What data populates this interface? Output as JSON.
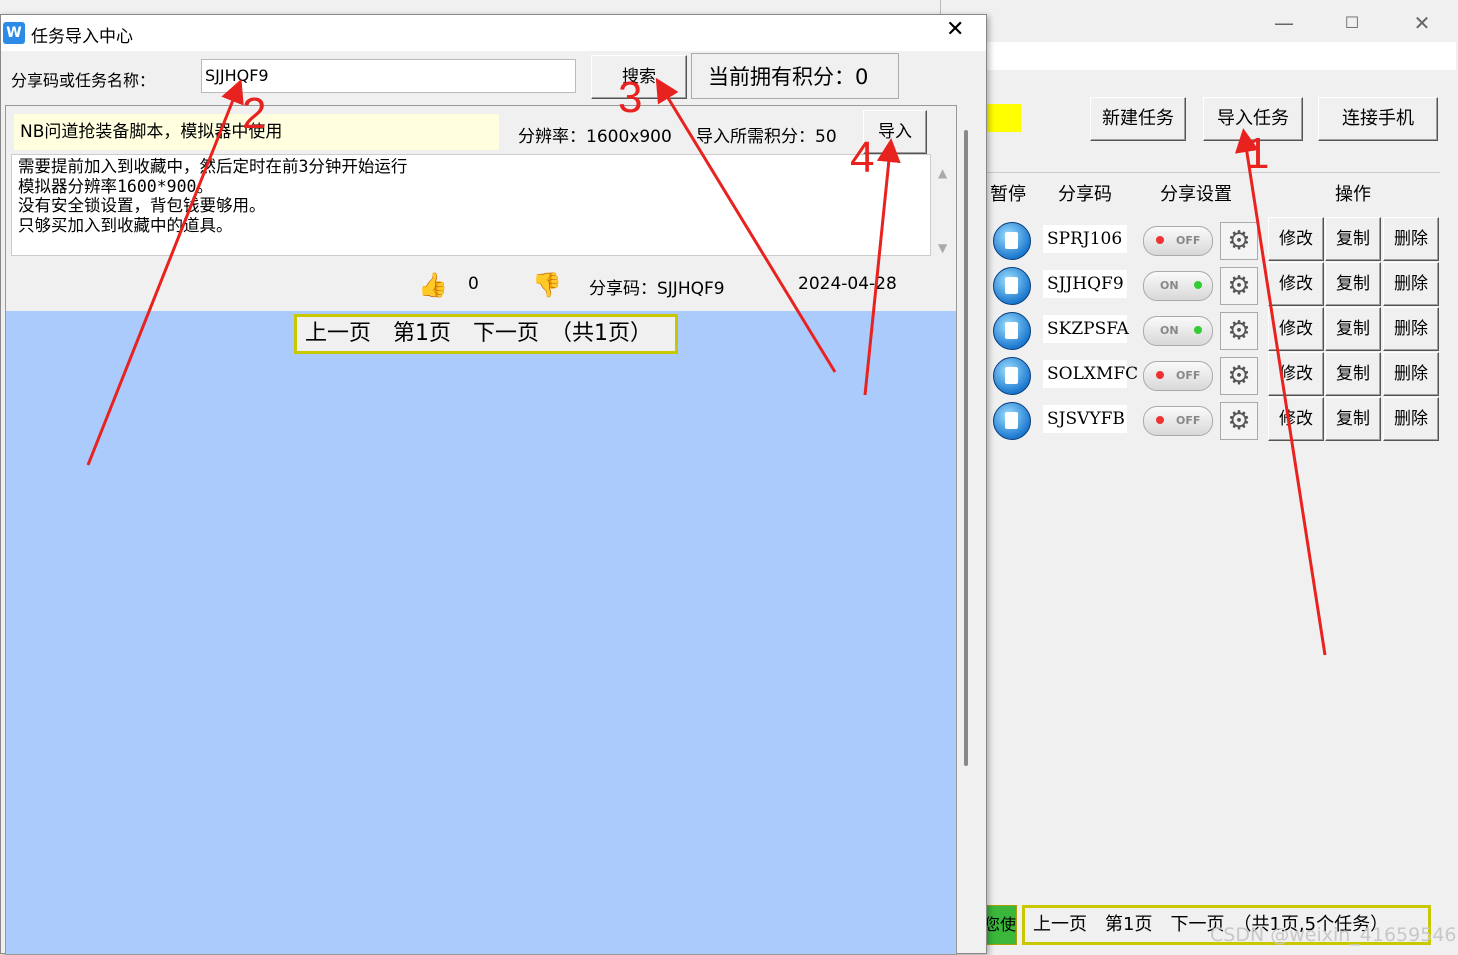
{
  "main_window": {
    "top_buttons": [
      "新建任务",
      "导入任务",
      "连接手机"
    ],
    "table_headers": [
      "暂停",
      "分享码",
      "分享设置",
      "操作"
    ],
    "tasks": [
      {
        "code": "SPRJ106",
        "state": "OFF"
      },
      {
        "code": "SJJHQF9",
        "state": "ON"
      },
      {
        "code": "SKZPSFA",
        "state": "ON"
      },
      {
        "code": "SOLXMFC",
        "state": "OFF"
      },
      {
        "code": "SJSVYFB",
        "state": "OFF"
      }
    ],
    "actions": [
      "修改",
      "复制",
      "删除"
    ],
    "left_tag": "您使",
    "pager": "上一页　第1页　下一页　（共1页,5个任务）",
    "watermark": "CSDN @weixin_41659546"
  },
  "dialog": {
    "title": "任务导入中心",
    "search_label": "分享码或任务名称：",
    "search_value": "SJJHQF9",
    "search_button": "搜索",
    "points_label": "当前拥有积分：0",
    "result": {
      "name": "NB问道抢装备脚本，模拟器中使用",
      "resolution": "分辨率：1600x900",
      "cost": "导入所需积分：50",
      "import_button": "导入",
      "description": [
        "需要提前加入到收藏中，然后定时在前3分钟开始运行",
        "模拟器分辨率1600*900。",
        "没有安全锁设置，背包钱要够用。",
        "只够买加入到收藏中的道具。"
      ],
      "likes": "0",
      "share_code": "分享码：SJJHQF9",
      "date": "2024-04-28"
    },
    "pager": "上一页　第1页　下一页　（共1页）"
  },
  "annotations": [
    "1",
    "2",
    "3",
    "4"
  ],
  "colors": {
    "annotation": "#e8231f",
    "content_bg": "#abcbfd",
    "pager_border": "#c8c800",
    "yellow_block": "#ffff00"
  }
}
